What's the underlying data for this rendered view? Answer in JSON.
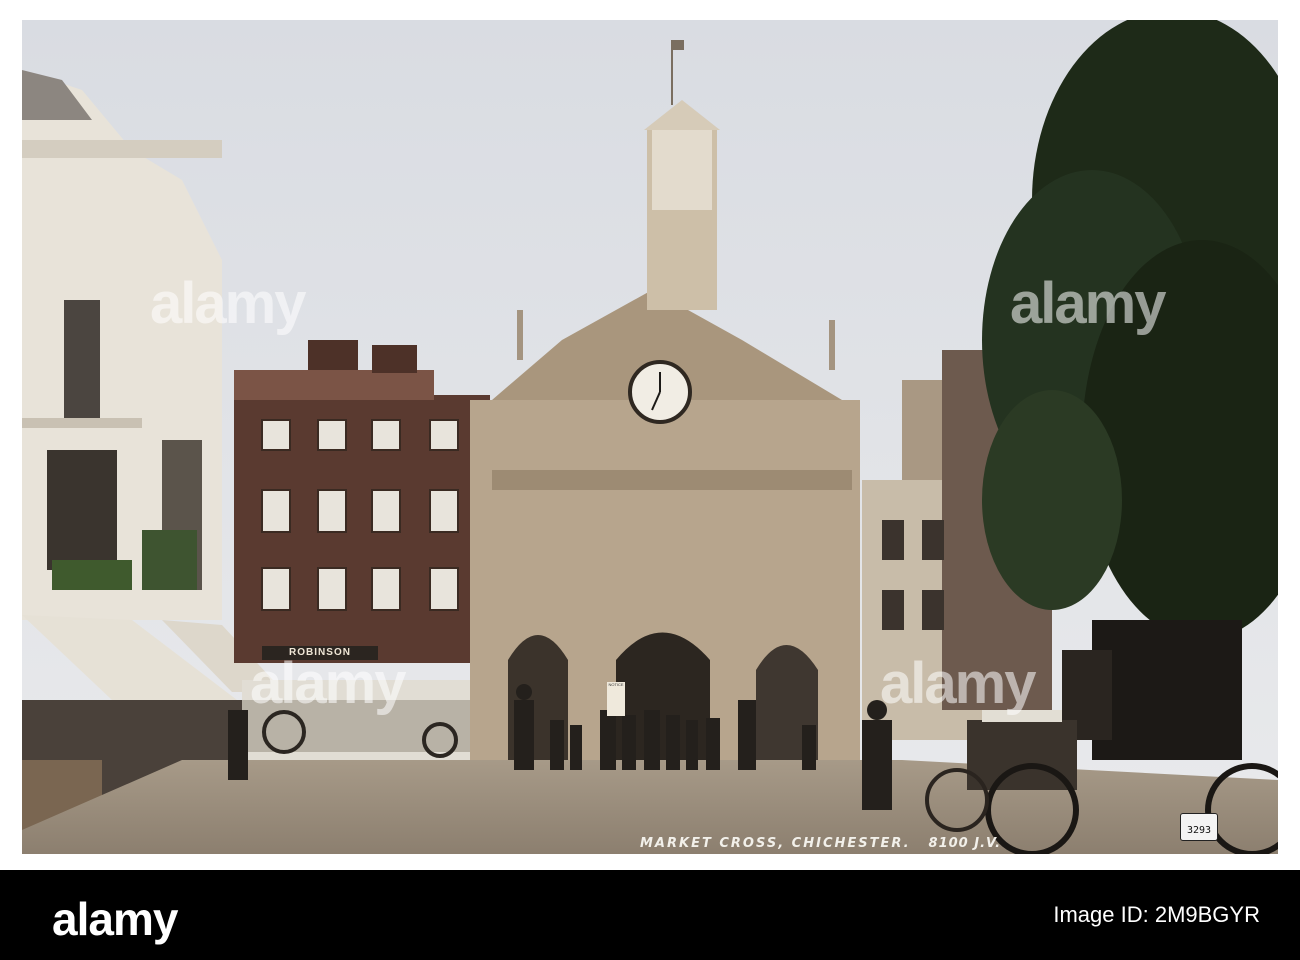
{
  "photo": {
    "caption_title": "MARKET CROSS, CHICHESTER.",
    "caption_number": "8100 J.V.",
    "shop_sign": "ROBINSON",
    "notice_board": "NOTICE",
    "carriage_plate": "3293"
  },
  "watermark": {
    "text": "alamy"
  },
  "footer": {
    "logo": "alamy",
    "logo_site": "",
    "image_id": "Image ID: 2M9BGYR",
    "bg_color": "#000000"
  }
}
